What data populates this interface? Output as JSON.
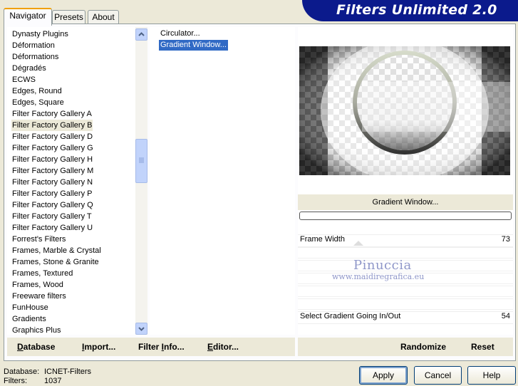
{
  "tabs": [
    {
      "label": "Navigator"
    },
    {
      "label": "Presets"
    },
    {
      "label": "About"
    }
  ],
  "title": "Filters Unlimited 2.0",
  "categories": [
    "Dynasty Plugins",
    "Déformation",
    "Déformations",
    "Dégradés",
    "ECWS",
    "Edges, Round",
    "Edges, Square",
    "Filter Factory Gallery A",
    "Filter Factory Gallery B",
    "Filter Factory Gallery D",
    "Filter Factory Gallery G",
    "Filter Factory Gallery H",
    "Filter Factory Gallery M",
    "Filter Factory Gallery N",
    "Filter Factory Gallery P",
    "Filter Factory Gallery Q",
    "Filter Factory Gallery T",
    "Filter Factory Gallery U",
    "Forrest's Filters",
    "Frames, Marble & Crystal",
    "Frames, Stone & Granite",
    "Frames, Textured",
    "Frames, Wood",
    "Freeware filters",
    "FunHouse",
    "Gradients",
    "Graphics Plus"
  ],
  "selected_category": "Filter Factory Gallery B",
  "filters": [
    "Circulator...",
    "Gradient Window..."
  ],
  "selected_filter": "Gradient Window...",
  "preview": {
    "filter_name": "Gradient Window..."
  },
  "params": [
    {
      "label": "Frame Width",
      "value": "73"
    },
    {
      "label": "Select Gradient Going In/Out",
      "value": "54"
    }
  ],
  "watermark": {
    "name": "Pinuccia",
    "url": "www.maidiregrafica.eu"
  },
  "left_bar": {
    "database": {
      "u": "D",
      "rest": "atabase"
    },
    "import": {
      "u": "I",
      "rest": "mport..."
    },
    "filter_info": {
      "pre": "Filter ",
      "u": "I",
      "rest": "nfo..."
    },
    "editor": {
      "u": "E",
      "rest": "ditor..."
    }
  },
  "right_bar": {
    "randomize": "Randomize",
    "reset": "Reset"
  },
  "status": {
    "database_label": "Database:",
    "database_value": "ICNET-Filters",
    "filters_label": "Filters:",
    "filters_value": "1037"
  },
  "buttons": {
    "apply": "Apply",
    "cancel": "Cancel",
    "help": "Help"
  }
}
